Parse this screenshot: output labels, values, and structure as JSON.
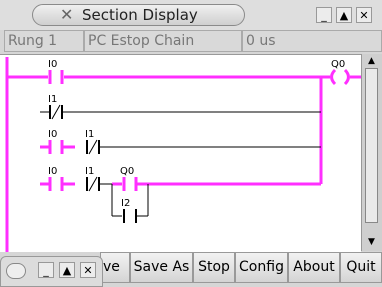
{
  "window": {
    "title": "Section Display",
    "close_glyph": "✕",
    "buttons": [
      "_",
      "▲",
      "✕"
    ]
  },
  "status": {
    "rung": "Rung 1",
    "section": "PC Estop Chain",
    "time": "0 us"
  },
  "ladder": {
    "rail_color": "#ff2fff",
    "contacts": {
      "r1": "I0",
      "r2": "I1",
      "r3a": "I0",
      "r3b": "I1",
      "r4a": "I0",
      "r4b": "I1",
      "r4c": "Q0",
      "r5": "I2"
    },
    "coil": "Q0"
  },
  "toolbar": {
    "partial": "ve",
    "save_as": "Save As",
    "stop": "Stop",
    "config": "Config",
    "about": "About",
    "quit": "Quit"
  },
  "mini_window": {
    "buttons": [
      "_",
      "▲",
      "✕"
    ]
  }
}
